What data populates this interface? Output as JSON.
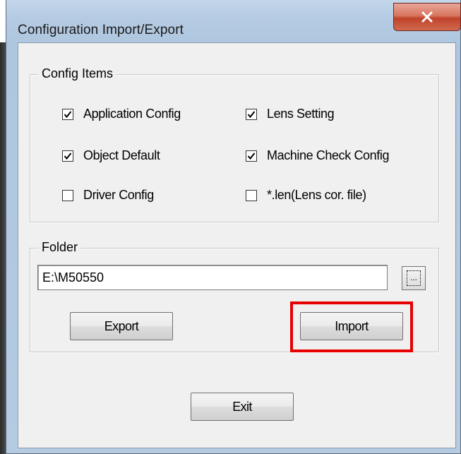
{
  "window": {
    "title": "Configuration Import/Export",
    "close_glyph": "x"
  },
  "config_items": {
    "label": "Config Items",
    "checkboxes": [
      {
        "label": "Application Config",
        "checked": true
      },
      {
        "label": "Lens Setting",
        "checked": true
      },
      {
        "label": "Object Default",
        "checked": true
      },
      {
        "label": "Machine Check Config",
        "checked": true
      },
      {
        "label": "Driver Config",
        "checked": false
      },
      {
        "label": "*.len(Lens cor. file)",
        "checked": false
      }
    ]
  },
  "folder": {
    "label": "Folder",
    "path_value": "E:\\M50550",
    "browse_label": "...",
    "export_label": "Export",
    "import_label": "Import"
  },
  "footer": {
    "exit_label": "Exit"
  },
  "colors": {
    "highlight": "#e60000",
    "dialog_bg": "#f0f0f0"
  }
}
